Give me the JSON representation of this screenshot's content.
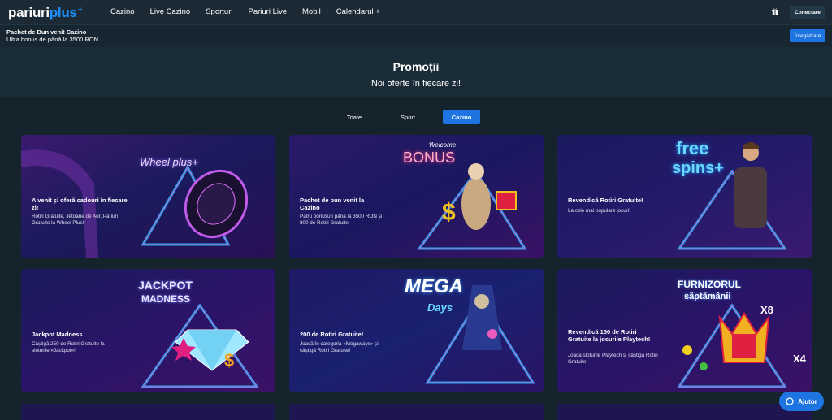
{
  "header": {
    "logo_part1": "pariuri",
    "logo_part2": "plus",
    "logo_plus": "+",
    "nav": [
      "Cazino",
      "Live Cazino",
      "Sporturi",
      "Pariuri Live",
      "Mobil",
      "Calendarul +"
    ],
    "gift_icon": "gift-icon",
    "login_label": "Conectare"
  },
  "bonus_bar": {
    "title": "Pachet de Bun venit Cazino",
    "subtitle": "Ultra bonus de până la 3500 RON",
    "register_label": "Înregistrare"
  },
  "hero": {
    "title": "Promoții",
    "subtitle": "Noi oferte în fiecare zi!"
  },
  "tabs": [
    {
      "label": "Toate",
      "active": false
    },
    {
      "label": "Sport",
      "active": false
    },
    {
      "label": "Cazino",
      "active": true
    }
  ],
  "cards": [
    {
      "title": "A venit și oferă cadouri în fiecare zi!",
      "desc": "Rotiri Gratuite, Jetoane de Aur, Pariuri Gratuite la Wheel Plus!",
      "art_text": "Wheel plus+"
    },
    {
      "title": "Pachet de bun venit la Cazino",
      "desc": "Patru bonusuri până la 3500 RON și 800 de Rotiri Gratuite",
      "art_text": "BONUS",
      "art_text2": "Welcome"
    },
    {
      "title": "Revendică Rotiri Gratuite!",
      "desc": "La cele mai populare jocuri!",
      "art_text": "free",
      "art_text2": "spins+"
    },
    {
      "title": "Jackpot Madness",
      "desc": "Câștigă 250 de Rotiri Gratuite la sloturile «Jackpot»!",
      "art_text": "JACKPOT",
      "art_text2": "MADNESS"
    },
    {
      "title": "200 de Rotiri Gratuite!",
      "desc": "Joacă în categoria «Megaways» și câștigă Rotiri Gratuite!",
      "art_text": "MEGA",
      "art_text2": "Days"
    },
    {
      "title": "Revendică 150 de Rotiri Gratuite la jocurile Playtech!",
      "desc": "Joacă sloturile Playtech și câștigă Rotiri Gratuite!",
      "art_text": "FURNIZORUL",
      "art_text2": "săptămânii"
    }
  ],
  "help": {
    "label": "Ajutor",
    "icon": "chat-icon"
  }
}
